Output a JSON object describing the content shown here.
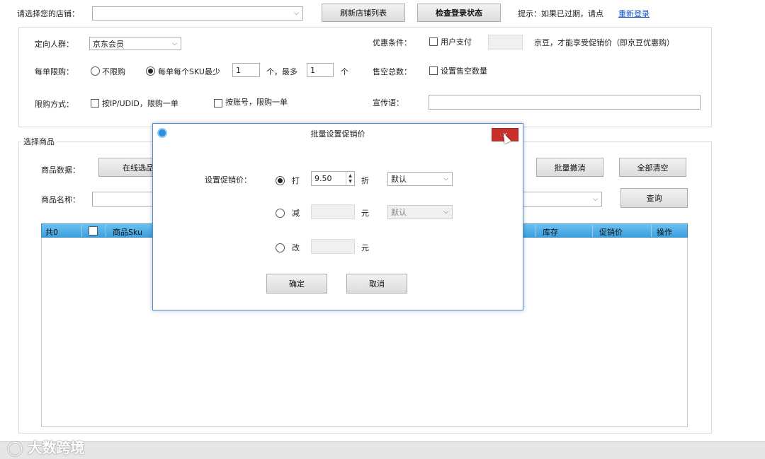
{
  "top": {
    "store_label": "请选择您的店铺：",
    "store_value": "",
    "refresh_button": "刷新店铺列表",
    "check_login_button": "检查登录状态",
    "hint_text": "提示：如果已过期，请点",
    "relogin_link": "重新登录"
  },
  "settings": {
    "audience_label": "定向人群：",
    "audience_value": "京东会员",
    "discount_cond_label": "优惠条件：",
    "user_pay_label": "用户支付",
    "user_pay_value": "",
    "jingdou_text": "京豆，才能享受促销价（即京豆优惠购）",
    "limit_label": "每单限购：",
    "no_limit_label": "不限购",
    "per_sku_label": "每单每个SKU最少",
    "min_value": "1",
    "max_label": "个，最多",
    "max_value": "1",
    "unit_label": "个",
    "sellout_label": "售空总数：",
    "sellout_check_label": "设置售空数量",
    "limit_method_label": "限购方式：",
    "by_ip_label": "按IP/UDID，限购一单",
    "by_account_label": "按账号，限购一单",
    "slogan_label": "宣传语：",
    "slogan_value": ""
  },
  "products": {
    "group_title": "选择商品",
    "data_label": "商品数据：",
    "online_select_button": "在线选品",
    "batch_cancel_button": "批量撤消",
    "clear_all_button": "全部清空",
    "name_label": "商品名称：",
    "name_value": "",
    "query_button": "查询",
    "grid": {
      "count_label": "共0",
      "col_sku": "商品Sku",
      "col_stock": "库存",
      "col_promo_price": "促销价",
      "col_action": "操作"
    }
  },
  "dialog": {
    "title": "批量设置促销价",
    "close_label": "x",
    "set_price_label": "设置促销价：",
    "discount_option": "打",
    "discount_value": "9.50",
    "discount_unit": "折",
    "discount_mode": "默认",
    "minus_option": "减",
    "minus_value": "",
    "minus_unit": "元",
    "minus_mode": "默认",
    "change_option": "改",
    "change_value": "",
    "change_unit": "元",
    "ok_button": "确定",
    "cancel_button": "取消"
  },
  "watermark": "大数跨境"
}
